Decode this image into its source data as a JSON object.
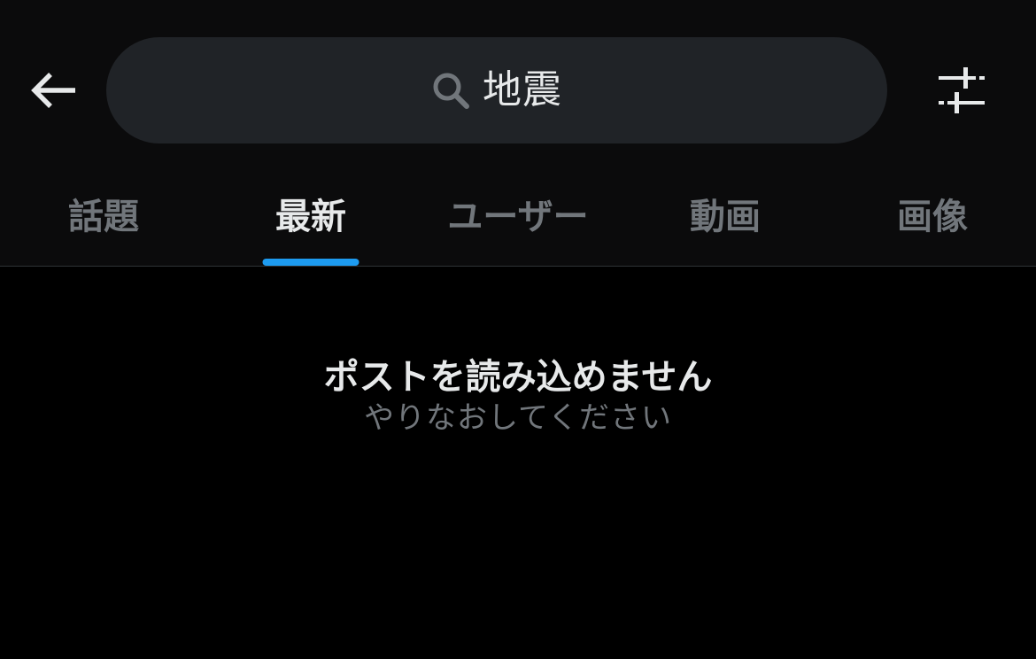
{
  "header": {
    "back_icon": "arrow-left-icon",
    "search": {
      "icon": "search-icon",
      "query": "地震"
    },
    "filter_icon": "sliders-icon"
  },
  "tabs": [
    {
      "label": "話題",
      "active": false
    },
    {
      "label": "最新",
      "active": true
    },
    {
      "label": "ユーザー",
      "active": false
    },
    {
      "label": "動画",
      "active": false
    },
    {
      "label": "画像",
      "active": false
    }
  ],
  "empty_state": {
    "title": "ポストを読み込めません",
    "subtitle": "やりなおしてください"
  },
  "colors": {
    "background": "#000000",
    "header_background": "#0b0b0c",
    "search_background": "#202327",
    "primary_text": "#e7e9ea",
    "secondary_text": "#71767b",
    "accent": "#1d9bf0",
    "divider": "#2f3336"
  }
}
